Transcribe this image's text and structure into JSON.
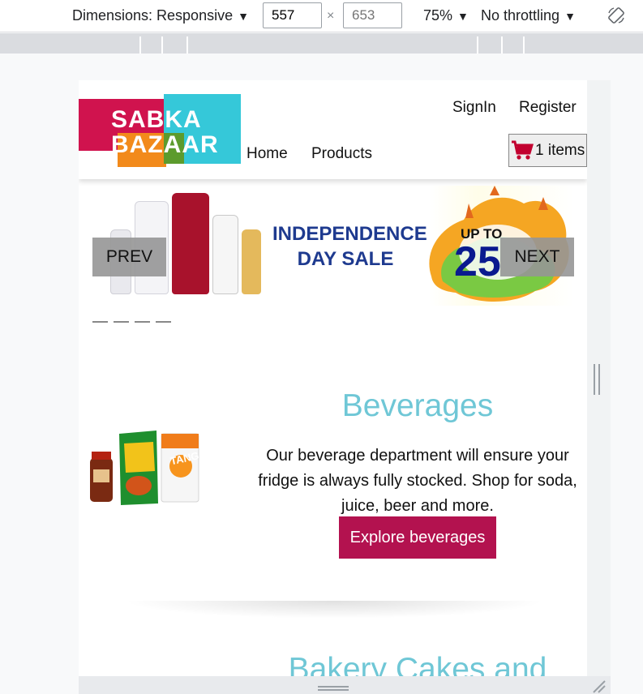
{
  "devtools": {
    "dimensions_label": "Dimensions: Responsive",
    "width_value": "557",
    "height_placeholder": "653",
    "times": "×",
    "zoom": "75%",
    "throttling": "No throttling"
  },
  "header": {
    "logo_line1": "SABKA",
    "logo_line2": "BAZAAR",
    "signin": "SignIn",
    "register": "Register",
    "nav": [
      "Home",
      "Products"
    ],
    "cart_label": "1 items"
  },
  "carousel": {
    "headline_line1": "INDEPENDENCE",
    "headline_line2": "DAY SALE",
    "offer_prefix": "UP TO",
    "offer_value": "25",
    "prev_label": "PREV",
    "next_label": "NEXT",
    "dot_count": 4
  },
  "categories": [
    {
      "title": "Beverages",
      "description": "Our beverage department will ensure your fridge is always fully stocked. Shop for soda, juice, beer and more.",
      "button_label": "Explore beverages"
    },
    {
      "title": "Bakery Cakes and"
    }
  ],
  "colors": {
    "accent_teal": "#6fc7d6",
    "button_crimson": "#b3124f",
    "headline_blue": "#1e3a8f"
  }
}
